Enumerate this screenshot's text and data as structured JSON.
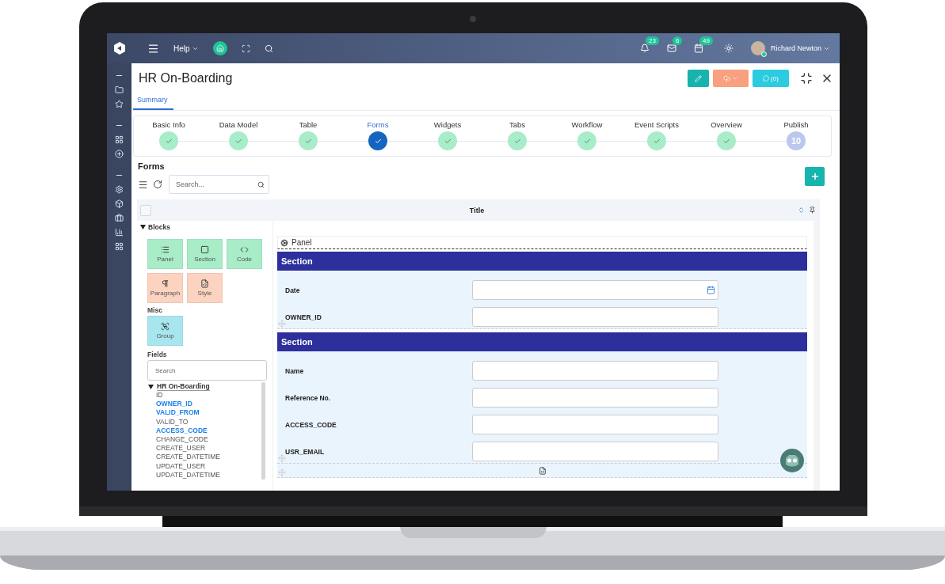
{
  "topbar": {
    "help": "Help",
    "badges": [
      {
        "kind": "bell",
        "count": "23"
      },
      {
        "kind": "mail",
        "count": "6"
      },
      {
        "kind": "calendar",
        "count": "49"
      }
    ],
    "user": "Richard Newton"
  },
  "page": {
    "title": "HR On-Boarding",
    "comments": "(0)",
    "tabs": [
      {
        "label": "Summary",
        "selected": true
      }
    ]
  },
  "steps": [
    {
      "label": "Basic Info",
      "completed": true,
      "selected": false
    },
    {
      "label": "Data Model",
      "completed": true,
      "selected": false
    },
    {
      "label": "Table",
      "completed": true,
      "selected": false
    },
    {
      "label": "Forms",
      "completed": true,
      "selected": true
    },
    {
      "label": "Widgets",
      "completed": true,
      "selected": false
    },
    {
      "label": "Tabs",
      "completed": true,
      "selected": false
    },
    {
      "label": "Workflow",
      "completed": true,
      "selected": false
    },
    {
      "label": "Event Scripts",
      "completed": true,
      "selected": false
    },
    {
      "label": "Overview",
      "completed": true,
      "selected": false
    },
    {
      "label": "Publish",
      "completed": false,
      "selected": false,
      "number": "10"
    }
  ],
  "forms": {
    "title": "Forms",
    "search_placeholder": "Search...",
    "column": "Title",
    "all_checked": false
  },
  "palette": {
    "blocks_heading": "Blocks",
    "blocks": [
      {
        "label": "Panel",
        "kind": "list",
        "color": "#a8ecc8"
      },
      {
        "label": "Section",
        "kind": "square",
        "color": "#a8ecc8"
      },
      {
        "label": "Code",
        "kind": "code",
        "color": "#a8ecc8"
      },
      {
        "label": "Paragraph",
        "kind": "pilcrow",
        "color": "#fbd3c0"
      },
      {
        "label": "Style",
        "kind": "css",
        "color": "#fbd3c0"
      }
    ],
    "misc_heading": "Misc",
    "misc": [
      {
        "label": "Group",
        "kind": "group",
        "color": "#a7e6ef"
      }
    ],
    "fields_heading": "Fields",
    "fields_placeholder": "Search",
    "tree": {
      "label": "HR On-Boarding",
      "expanded": true,
      "children": [
        {
          "label": "ID",
          "used": false
        },
        {
          "label": "OWNER_ID",
          "used": true
        },
        {
          "label": "VALID_FROM",
          "used": true
        },
        {
          "label": "VALID_TO",
          "used": false
        },
        {
          "label": "ACCESS_CODE",
          "used": true
        },
        {
          "label": "CHANGE_CODE",
          "used": false
        },
        {
          "label": "CREATE_USER",
          "used": false
        },
        {
          "label": "CREATE_DATETIME",
          "used": false
        },
        {
          "label": "UPDATE_USER",
          "used": false
        },
        {
          "label": "UPDATE_DATETIME",
          "used": false
        }
      ]
    }
  },
  "canvas": {
    "panel": "Panel",
    "sections": [
      {
        "title": "Section",
        "fields": [
          {
            "label": "Date",
            "kind": "date"
          },
          {
            "label": "OWNER_ID",
            "kind": "text"
          }
        ]
      },
      {
        "title": "Section",
        "fields": [
          {
            "label": "Name",
            "kind": "text"
          },
          {
            "label": "Reference No.",
            "kind": "text"
          },
          {
            "label": "ACCESS_CODE",
            "kind": "text"
          },
          {
            "label": "USR_EMAIL",
            "kind": "text"
          }
        ]
      }
    ]
  }
}
